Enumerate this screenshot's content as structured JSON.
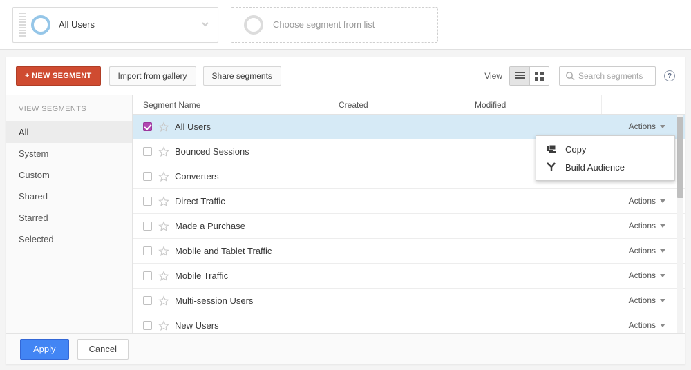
{
  "segment_bar": {
    "selected_chip": {
      "label": "All Users",
      "icon": "segment-ring-icon",
      "chevron": "chevron-down-icon"
    },
    "empty_chip": {
      "placeholder": "Choose segment from list",
      "icon": "segment-ring-empty-icon"
    }
  },
  "toolbar": {
    "new_segment_label": "+ NEW SEGMENT",
    "import_label": "Import from gallery",
    "share_label": "Share segments",
    "view_label": "View",
    "list_view_icon": "list-view-icon",
    "grid_view_icon": "grid-view-icon",
    "search_placeholder": "Search segments",
    "search_value": "",
    "search_icon": "search-icon",
    "help_icon": "help-icon",
    "help_glyph": "?"
  },
  "sidebar": {
    "heading": "VIEW SEGMENTS",
    "items": [
      {
        "label": "All",
        "active": true
      },
      {
        "label": "System",
        "active": false
      },
      {
        "label": "Custom",
        "active": false
      },
      {
        "label": "Shared",
        "active": false
      },
      {
        "label": "Starred",
        "active": false
      },
      {
        "label": "Selected",
        "active": false
      }
    ]
  },
  "table": {
    "columns": [
      "Segment Name",
      "Created",
      "Modified"
    ],
    "actions_label": "Actions",
    "rows": [
      {
        "name": "All Users",
        "checked": true,
        "starred": false,
        "created": "",
        "modified": "",
        "selected": true
      },
      {
        "name": "Bounced Sessions",
        "checked": false,
        "starred": false,
        "created": "",
        "modified": "",
        "selected": false
      },
      {
        "name": "Converters",
        "checked": false,
        "starred": false,
        "created": "",
        "modified": "",
        "selected": false
      },
      {
        "name": "Direct Traffic",
        "checked": false,
        "starred": false,
        "created": "",
        "modified": "",
        "selected": false
      },
      {
        "name": "Made a Purchase",
        "checked": false,
        "starred": false,
        "created": "",
        "modified": "",
        "selected": false
      },
      {
        "name": "Mobile and Tablet Traffic",
        "checked": false,
        "starred": false,
        "created": "",
        "modified": "",
        "selected": false
      },
      {
        "name": "Mobile Traffic",
        "checked": false,
        "starred": false,
        "created": "",
        "modified": "",
        "selected": false
      },
      {
        "name": "Multi-session Users",
        "checked": false,
        "starred": false,
        "created": "",
        "modified": "",
        "selected": false
      },
      {
        "name": "New Users",
        "checked": false,
        "starred": false,
        "created": "",
        "modified": "",
        "selected": false
      }
    ]
  },
  "actions_menu": {
    "open": true,
    "items": [
      {
        "label": "Copy",
        "icon": "copy-icon"
      },
      {
        "label": "Build Audience",
        "icon": "build-audience-icon"
      }
    ]
  },
  "footer": {
    "apply_label": "Apply",
    "cancel_label": "Cancel"
  },
  "colors": {
    "new_segment_button": "#cf4b31",
    "apply_button": "#4285f4",
    "selected_row": "#d6eaf6",
    "checkbox_checked": "#b246b2",
    "segment_ring": "#95c6e8"
  }
}
